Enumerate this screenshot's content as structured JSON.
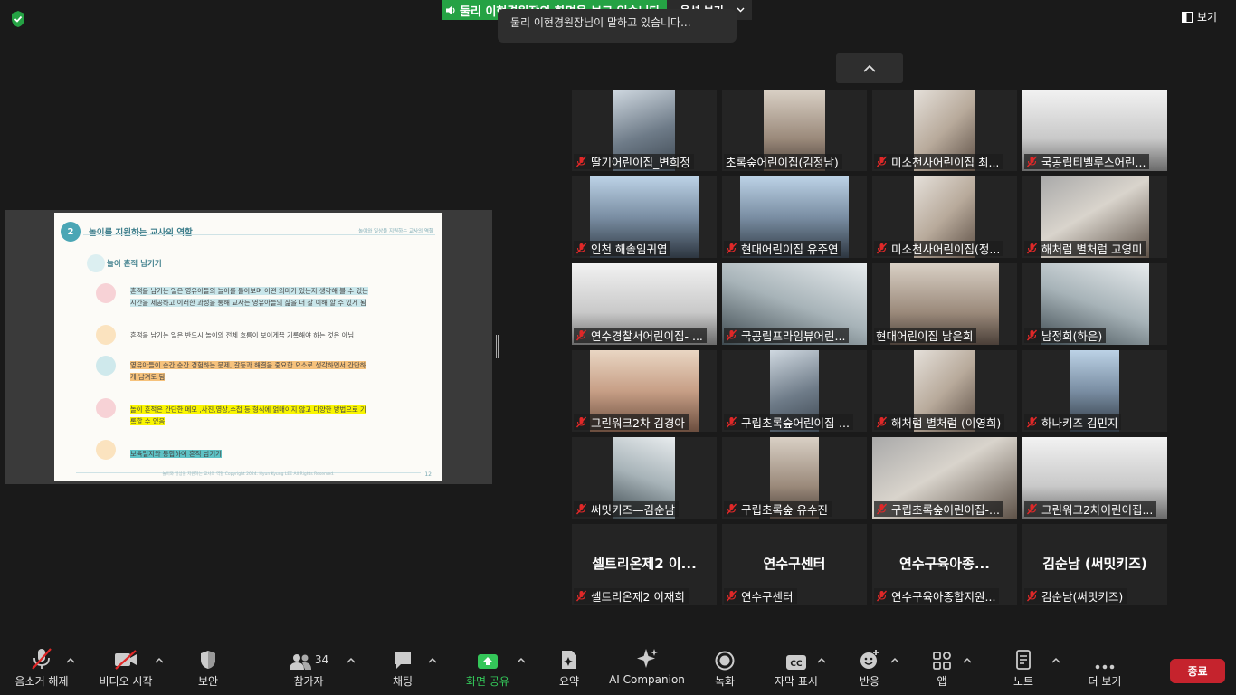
{
  "window": {
    "share_status": "둘리 이현경원장의 화면을 보고 있습니다",
    "options_label": "옵션 보기",
    "speaking_text": "둘리 이현경원장님이 말하고 있습니다...",
    "view_label": "보기"
  },
  "slide": {
    "number": "2",
    "title": "놀이를 지원하는 교사의 역할",
    "header_right": "놀이와 일상을 지원하는 교사의 역할",
    "subtitle": "놀이 흔적 남기기",
    "items": [
      {
        "line1": "흔적을 남기는 일은 영유아들의 놀이를 돌아보며 어떤 의미가 있는지 생각해 볼 수 있는",
        "line2": "시간을 제공하고 이러한 과정을 통해 교사는 영유아들의 삶을 더 잘 이해 할 수 있게 됨"
      },
      {
        "line1": "흔적을 남기는 일은 반드시 놀이의 전체 흐름이 보이게끔 기록해야 하는 것은 아님",
        "line2": ""
      },
      {
        "line1": "영유아들이 순간 순간 경험하는 문제, 갈등과 해결을 중요한 요소로 생각하면서 간단하",
        "line2": "게 남겨도 됨"
      },
      {
        "line1": "놀이 흔적은 간단한 메모 ,사진,영상,수첩 등 형식에 얽매이지 않고 다양한 방법으로 기",
        "line2": "록할 수 있음"
      },
      {
        "line1": "보육일지와 통합하여 흔적 남기기",
        "line2": ""
      }
    ],
    "footer": "놀이와 일상을 지원하는 교사의 역할 Copyright 2024. Hyun Kyung LEE All Rights Reserved.",
    "page": "12"
  },
  "participants": [
    {
      "name": "딸기어린이집_변희정",
      "muted": true
    },
    {
      "name": "초록숲어린이집(김정남)",
      "muted": false
    },
    {
      "name": "미소천사어린이집 최...",
      "muted": true
    },
    {
      "name": "국공립티벨루스어린...",
      "muted": true
    },
    {
      "name": "인천  해솔임귀엽",
      "muted": true
    },
    {
      "name": "현대어린이집  유주연",
      "muted": true
    },
    {
      "name": "미소천사어린이집(정...",
      "muted": true
    },
    {
      "name": "해처럼 별처럼 고영미",
      "muted": true
    },
    {
      "name": "연수경찰서어린이집- ...",
      "muted": true
    },
    {
      "name": "국공립프라임뷰어린...",
      "muted": true
    },
    {
      "name": "현대어린이집 남은희",
      "muted": false
    },
    {
      "name": "남정희(하은)",
      "muted": true
    },
    {
      "name": "그린워크2차 김경아",
      "muted": true
    },
    {
      "name": "구립초록숲어린이집-...",
      "muted": true
    },
    {
      "name": "해처럼 별처럼 (이영희)",
      "muted": true
    },
    {
      "name": "하나키즈 김민지",
      "muted": true
    },
    {
      "name": "써밋키즈—김순남",
      "muted": true
    },
    {
      "name": "구립초록숲 유수진",
      "muted": true
    },
    {
      "name": "구립초록숲어린이집-...",
      "muted": true
    },
    {
      "name": "그린워크2차어린이집...",
      "muted": true
    },
    {
      "name": "셀트리온제2 이재희",
      "display": "셀트리온제2 이...",
      "muted": true
    },
    {
      "name": "연수구센터",
      "display": "연수구센터",
      "muted": true
    },
    {
      "name": "연수구육아종합지원...",
      "display": "연수구육아종...",
      "muted": true
    },
    {
      "name": "김순남(써밋키즈)",
      "display": "김순남 (써밋키즈)",
      "muted": true
    }
  ],
  "toolbar": {
    "unmute": "음소거 해제",
    "start_video": "비디오 시작",
    "security": "보안",
    "participants": "참가자",
    "participant_count": "34",
    "chat": "채팅",
    "share_screen": "화면 공유",
    "summary": "요약",
    "ai_companion": "AI Companion",
    "record": "녹화",
    "captions": "자막 표시",
    "reactions": "반응",
    "apps": "앱",
    "notes": "노트",
    "more": "더 보기",
    "end": "종료"
  },
  "colors": {
    "share_banner": "#25a244",
    "end_button": "#c5232d",
    "share_active": "#34c659",
    "muted_icon": "#e02828"
  }
}
